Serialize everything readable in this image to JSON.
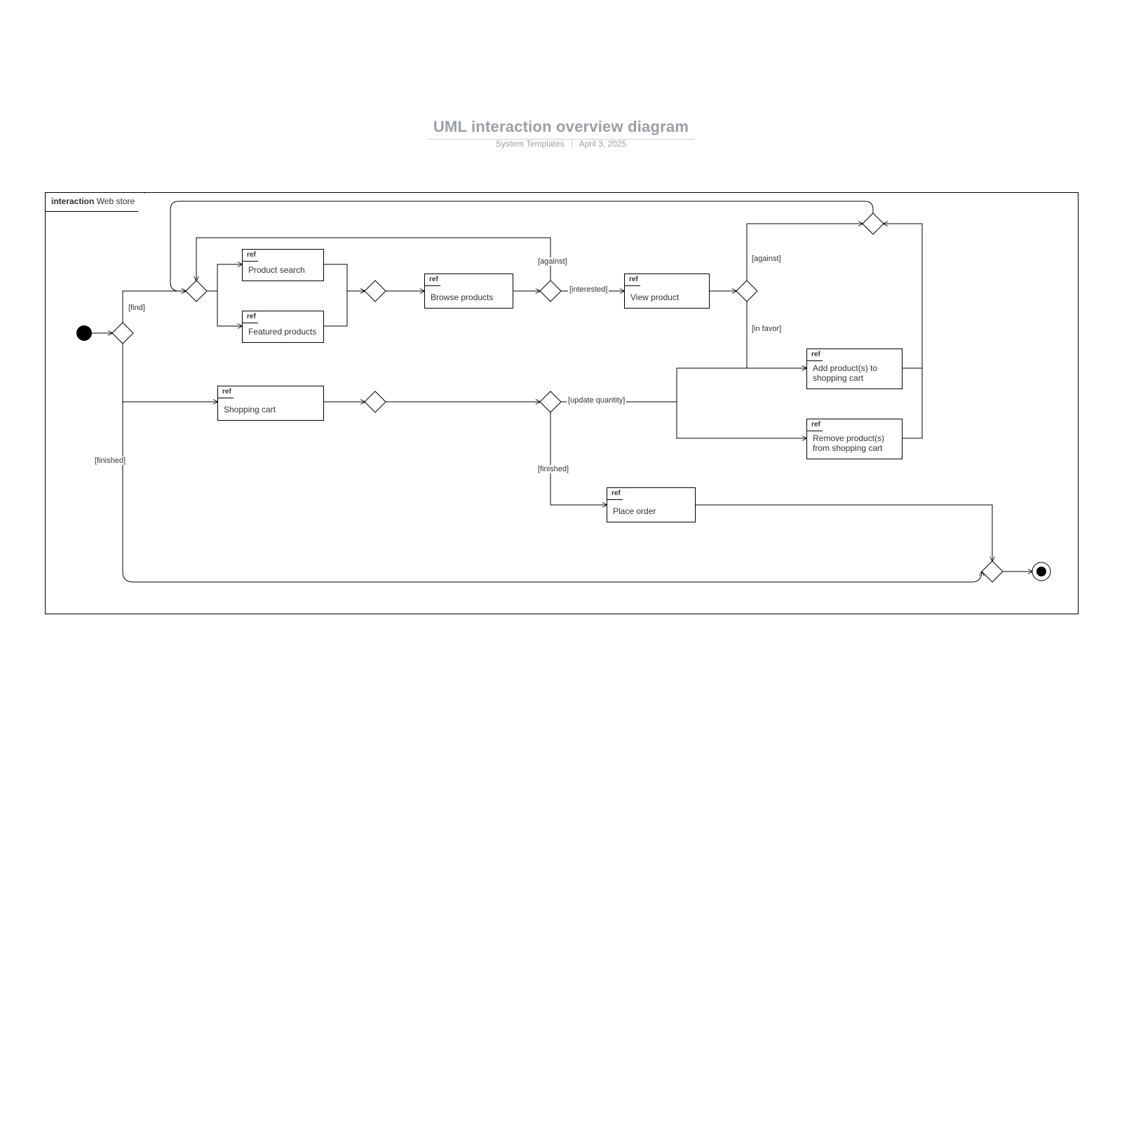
{
  "title": "UML interaction overview diagram",
  "subtitle_collection": "System Templates",
  "subtitle_date": "April 3, 2025",
  "frame_keyword": "interaction",
  "frame_name": "Web store",
  "ref_label": "ref",
  "refs": {
    "product_search": "Product search",
    "featured_products": "Featured products",
    "browse_products": "Browse products",
    "view_product": "View product",
    "shopping_cart": "Shopping cart",
    "add_product": "Add product(s) to shopping cart",
    "remove_product": "Remove product(s) from shopping cart",
    "place_order": "Place order"
  },
  "guards": {
    "find": "[find]",
    "finished": "[finished]",
    "against": "[against]",
    "interested": "[interested]",
    "in_favor": "[in favor]",
    "update_quantity": "[update quantity]"
  }
}
